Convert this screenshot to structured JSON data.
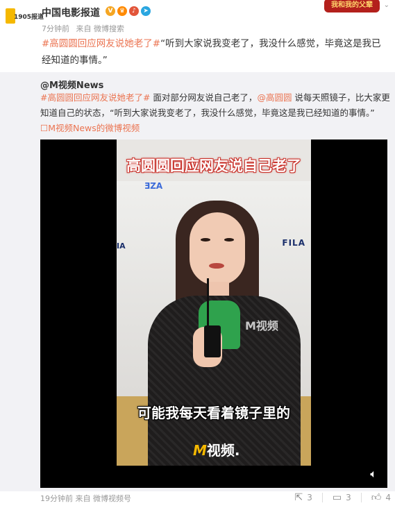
{
  "post": {
    "author": "中国电影报道",
    "avatar_text": "1905报道",
    "badges": [
      "V",
      "♛",
      "♪",
      "➤"
    ],
    "banner": "我和我的父辈",
    "time": "7分钟前",
    "source": "来自 微博搜索",
    "hashtag": "#高圆圆回应网友说她老了#",
    "quote": "“听到大家说我变老了，我没什么感觉，毕竟这是我已经知道的事情。”"
  },
  "repost": {
    "author": "@M视频News",
    "hashtag": "#高圆圆回应网友说她老了#",
    "text_1": " 面对部分网友说自己老了，",
    "mention": "@高圆圆",
    "text_2": " 说每天照镜子，比大家更知道自己的状态，“听到大家说我变老了，我没什么感觉，毕竟这是我已经知道的事情。” ",
    "video_link": "☐M视频News的微博视频",
    "video": {
      "caption_top": "高圆圆回应网友说自己老了",
      "caption_bottom": "可能我每天看着镜子里的",
      "watermark": "M视频",
      "brand_m": "M",
      "brand_text": "视频.",
      "logo_left": "ƎZA",
      "logo_fila": "FILA",
      "logo_left2": "IA"
    },
    "time": "19分钟前",
    "source": "来自 微博视频号",
    "repost_count": "3",
    "comment_count": "3",
    "like_count": "4"
  }
}
